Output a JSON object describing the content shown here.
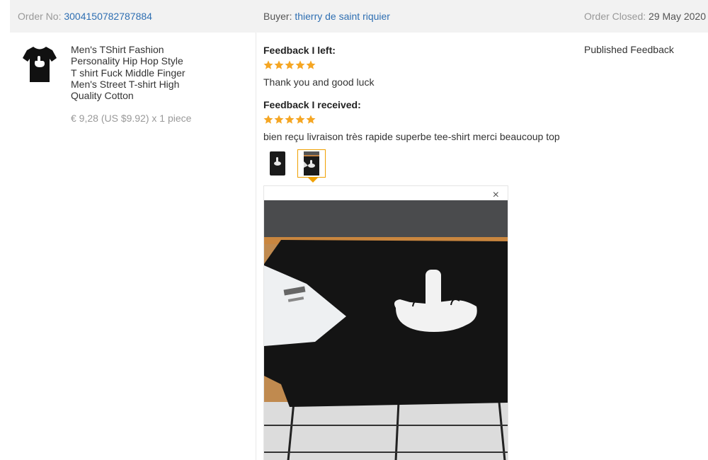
{
  "order": {
    "number_label": "Order No:",
    "number": "3004150782787884",
    "buyer_label": "Buyer:",
    "buyer": "thierry de saint riquier",
    "closed_label": "Order Closed:",
    "closed_date": "29 May 2020"
  },
  "product": {
    "title_lines": [
      "Men's TShirt Fashion",
      "Personality Hip Hop Style",
      "T shirt Fuck Middle Finger",
      "Men's Street T-shirt High",
      "Quality Cotton"
    ],
    "price": "€ 9,28 (US $9.92) x 1 piece"
  },
  "feedback_left": {
    "heading": "Feedback I left:",
    "stars": 5,
    "text": "Thank you and good luck"
  },
  "feedback_received": {
    "heading": "Feedback I received:",
    "stars": 5,
    "text": "bien reçu livraison très rapide superbe tee-shirt merci beaucoup top"
  },
  "gallery": {
    "active_index": 1,
    "close_symbol": "×"
  },
  "status": "Published Feedback",
  "colors": {
    "link": "#2f6fb2",
    "star": "#f5a623",
    "active_thumb_border": "#f0a000",
    "header_bg": "#f2f2f2"
  },
  "icons": [
    "tshirt-icon",
    "star-icon",
    "close-icon"
  ]
}
